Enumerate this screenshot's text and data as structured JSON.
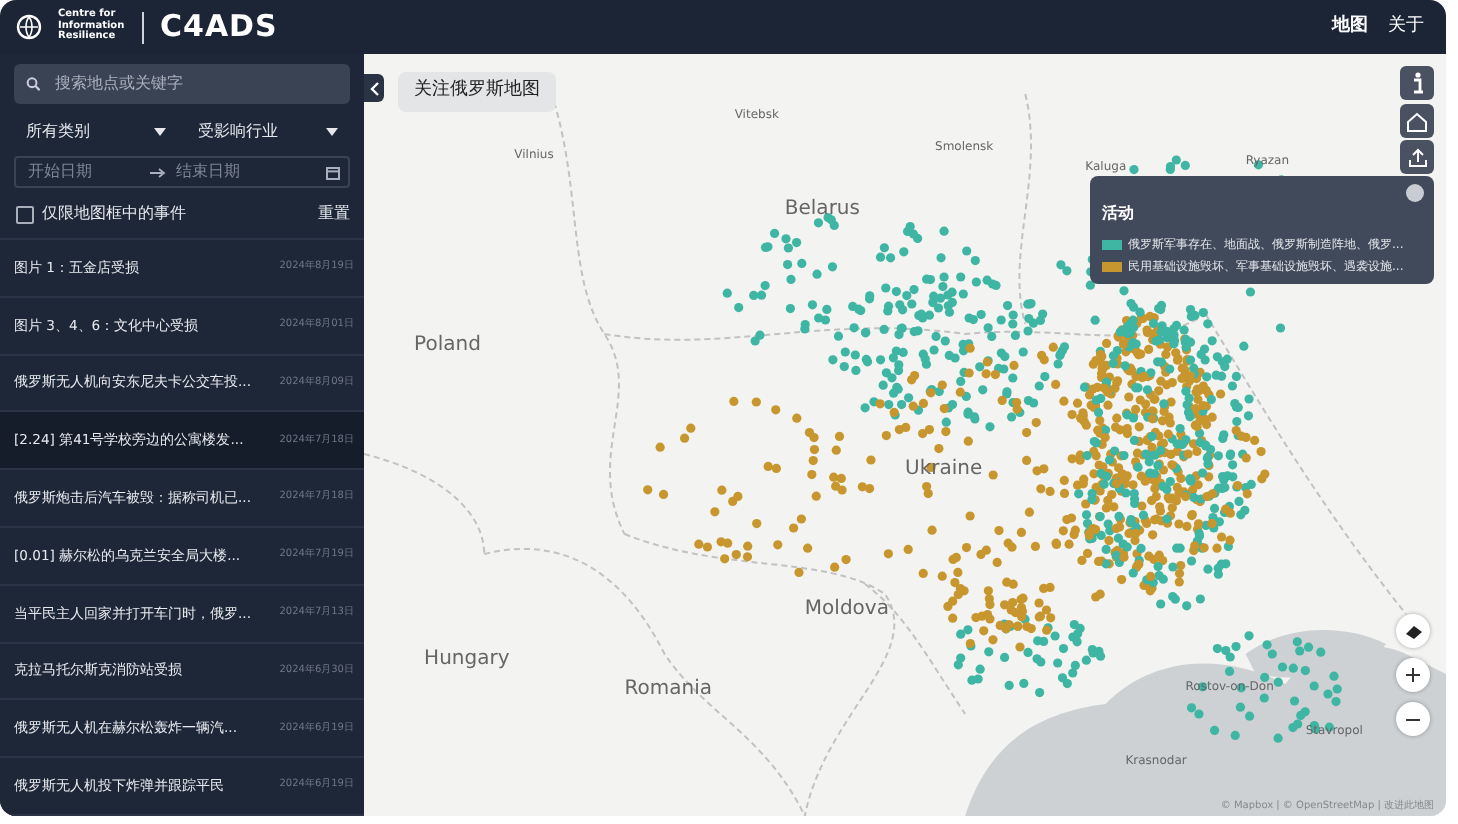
{
  "header": {
    "logo_org": "Centre for Information Resilience",
    "logo_brand": "C4ADS",
    "nav": [
      {
        "label": "地图",
        "selected": true
      },
      {
        "label": "关于",
        "selected": false
      }
    ]
  },
  "sidebar": {
    "search": {
      "placeholder": "搜索地点或关键字"
    },
    "filters": [
      {
        "label": "所有类别"
      },
      {
        "label": "受影响行业"
      }
    ],
    "date_start": {
      "placeholder": "开始日期"
    },
    "date_end": {
      "placeholder": "结束日期"
    },
    "map_only": {
      "label": "仅限地图框中的事件",
      "checked": false
    },
    "reset": "重置",
    "events": [
      {
        "title": "图片 1：五金店受损",
        "date": "2024年8月19日",
        "selected": false
      },
      {
        "title": "图片 3、4、6：文化中心受损",
        "date": "2024年8月01日",
        "selected": false
      },
      {
        "title": "俄罗斯无人机向安东尼夫卡公交车投...",
        "date": "2024年8月09日",
        "selected": false
      },
      {
        "title": "[2.24] 第41号学校旁边的公寓楼发...",
        "date": "2024年7月18日",
        "selected": true
      },
      {
        "title": "俄罗斯炮击后汽车被毁：据称司机已...",
        "date": "2024年7月18日",
        "selected": false
      },
      {
        "title": "[0.01] 赫尔松的乌克兰安全局大楼...",
        "date": "2024年7月19日",
        "selected": false
      },
      {
        "title": "当平民主人回家并打开车门时，俄罗...",
        "date": "2024年7月13日",
        "selected": false
      },
      {
        "title": "克拉马托尔斯克消防站受损",
        "date": "2024年6月30日",
        "selected": false
      },
      {
        "title": "俄罗斯无人机在赫尔松轰炸一辆汽...",
        "date": "2024年6月19日",
        "selected": false
      },
      {
        "title": "俄罗斯无人机投下炸弹并跟踪平民",
        "date": "2024年6月19日",
        "selected": false
      }
    ]
  },
  "map": {
    "title": "关注俄罗斯地图",
    "labels": [
      {
        "text": "Vitebsk",
        "kind": "city"
      },
      {
        "text": "Vilnius",
        "kind": "city"
      },
      {
        "text": "Smolensk",
        "kind": "city"
      },
      {
        "text": "Kaluga",
        "kind": "city"
      },
      {
        "text": "Ryazan",
        "kind": "city"
      },
      {
        "text": "Belarus",
        "kind": "country"
      },
      {
        "text": "Poland",
        "kind": "country"
      },
      {
        "text": "Ukraine",
        "kind": "country"
      },
      {
        "text": "Moldova",
        "kind": "country"
      },
      {
        "text": "Hungary",
        "kind": "country"
      },
      {
        "text": "Romania",
        "kind": "country"
      },
      {
        "text": "Rostov-on-Don",
        "kind": "city"
      },
      {
        "text": "Krasnodar",
        "kind": "city"
      },
      {
        "text": "Stavropol",
        "kind": "city"
      }
    ],
    "legend": {
      "title": "活动",
      "items": [
        {
          "label": "俄罗斯军事存在、地面战、俄罗斯制造阵地、俄罗...",
          "color": "#3fb5a3"
        },
        {
          "label": "民用基础设施毁坏、军事基础设施毁坏、遇袭设施...",
          "color": "#c8962e"
        }
      ]
    },
    "attribution": "© Mapbox | © OpenStreetMap | 改进此地图"
  }
}
